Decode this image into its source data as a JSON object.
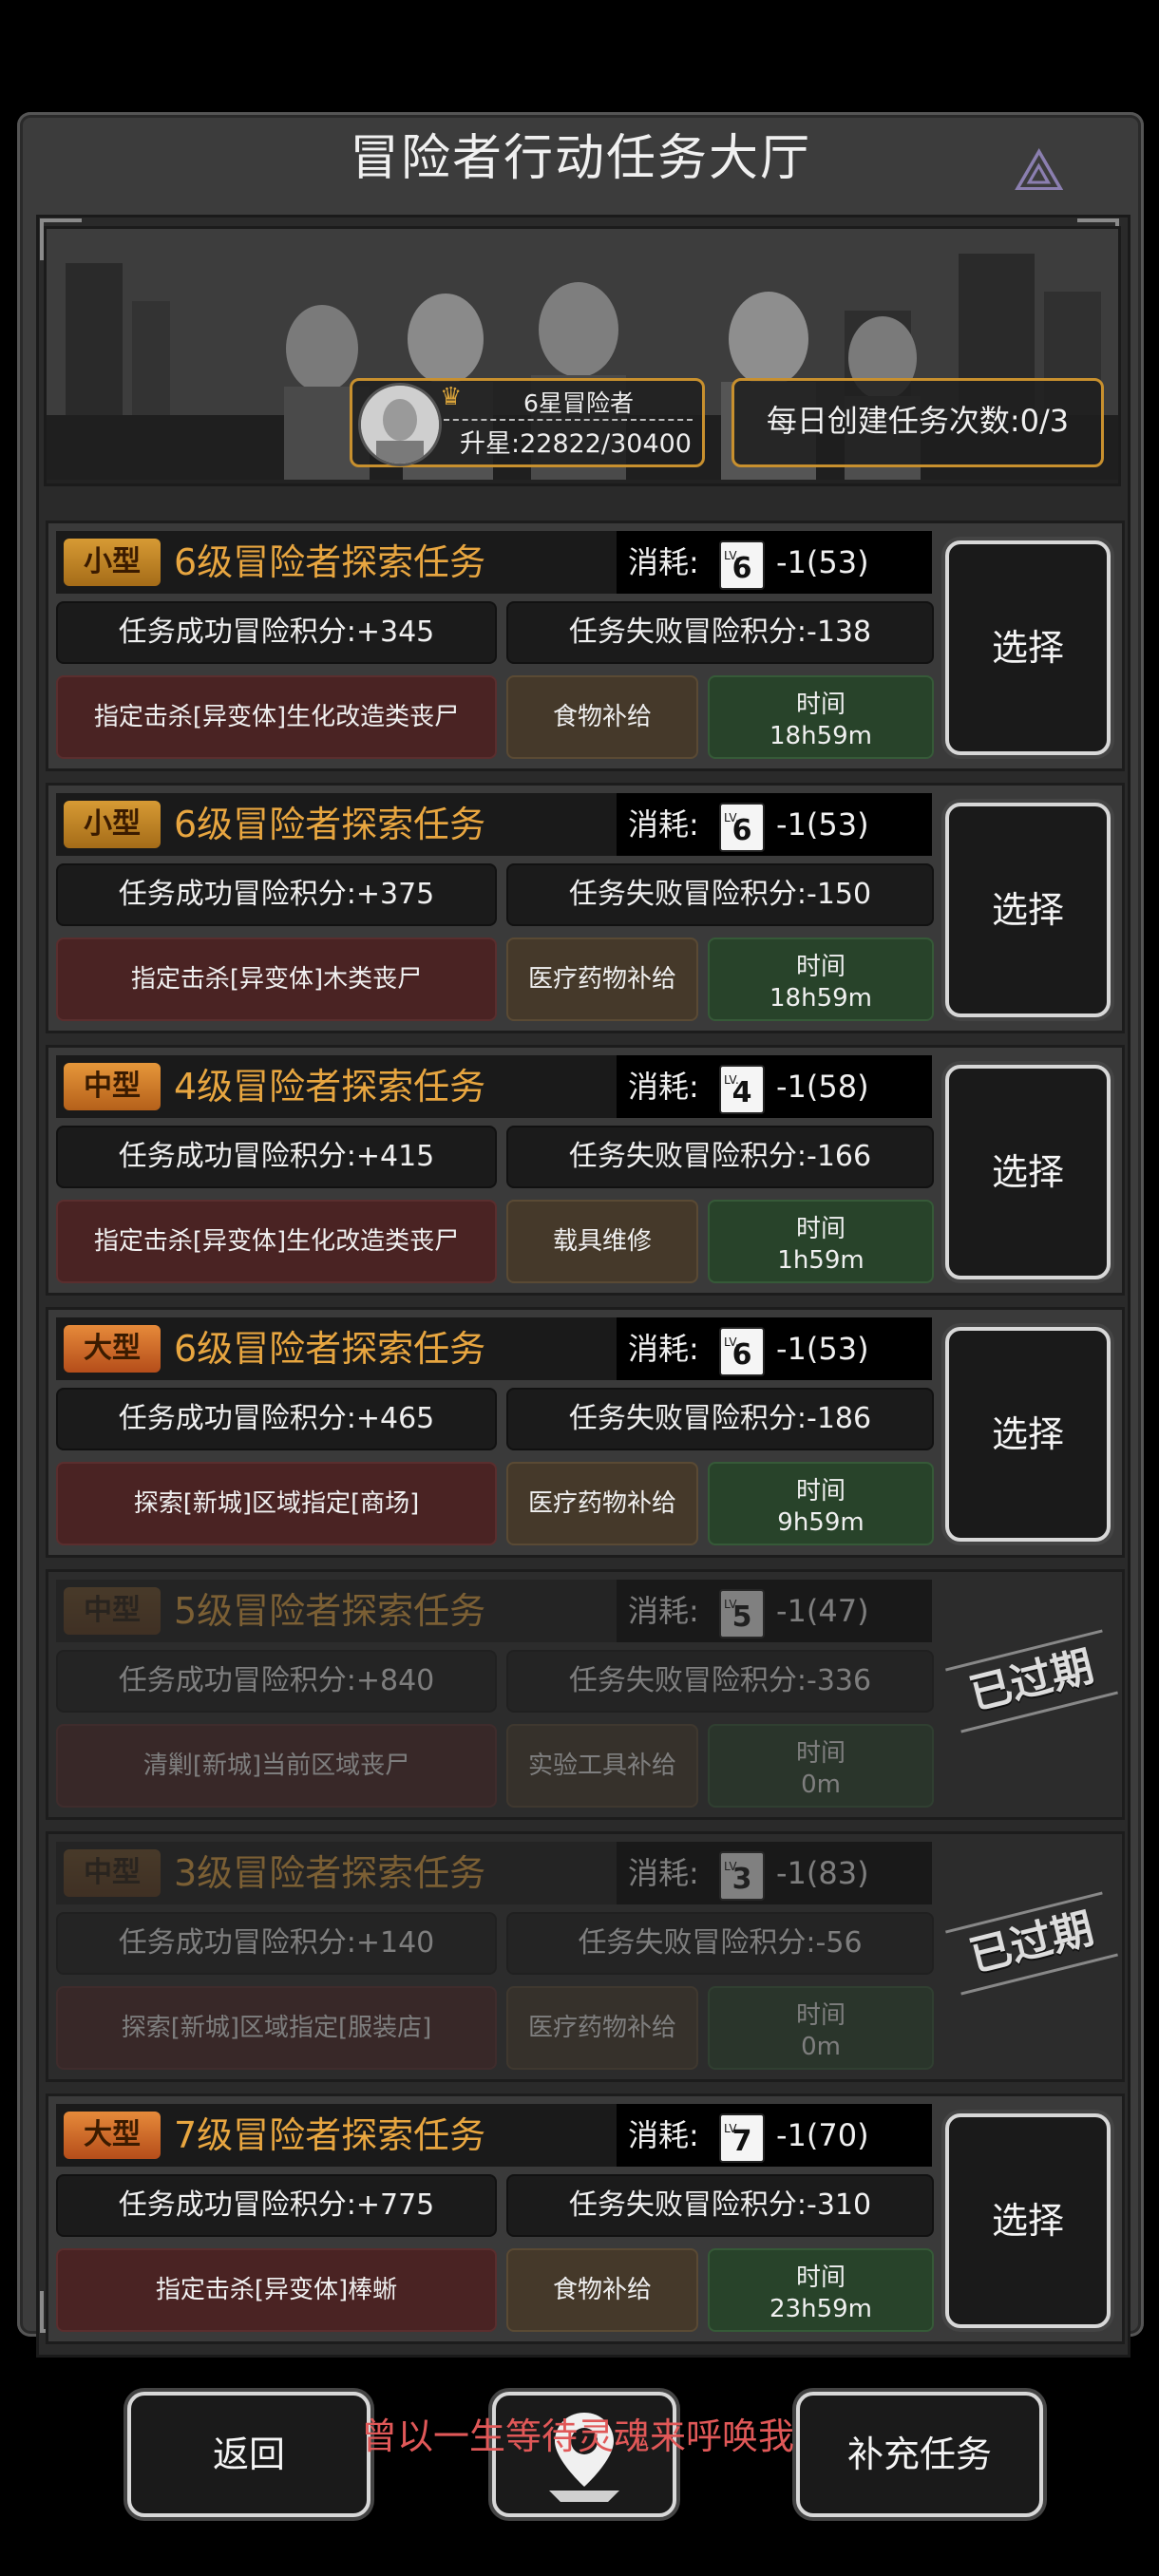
{
  "header": {
    "title": "冒险者行动任务大厅"
  },
  "banner": {
    "rank_name": "6星冒险者",
    "rank_progress": "升星:22822/30400",
    "daily_create": "每日创建任务次数:0/3"
  },
  "tasks": [
    {
      "size": "小型",
      "title": "6级冒险者探索任务",
      "cost_label": "消耗:",
      "lv_card": "6",
      "cost": "-1(53)",
      "success": "任务成功冒险积分:+345",
      "fail": "任务失败冒险积分:-138",
      "target": "指定击杀[异变体]生化改造类丧尸",
      "reward": "食物补给",
      "time_label": "时间",
      "time": "18h59m",
      "action": "选择"
    },
    {
      "size": "小型",
      "title": "6级冒险者探索任务",
      "cost_label": "消耗:",
      "lv_card": "6",
      "cost": "-1(53)",
      "success": "任务成功冒险积分:+375",
      "fail": "任务失败冒险积分:-150",
      "target": "指定击杀[异变体]木类丧尸",
      "reward": "医疗药物补给",
      "time_label": "时间",
      "time": "18h59m",
      "action": "选择"
    },
    {
      "size": "中型",
      "title": "4级冒险者探索任务",
      "cost_label": "消耗:",
      "lv_card": "4",
      "cost": "-1(58)",
      "success": "任务成功冒险积分:+415",
      "fail": "任务失败冒险积分:-166",
      "target": "指定击杀[异变体]生化改造类丧尸",
      "reward": "载具维修",
      "time_label": "时间",
      "time": "1h59m",
      "action": "选择"
    },
    {
      "size": "大型",
      "title": "6级冒险者探索任务",
      "cost_label": "消耗:",
      "lv_card": "6",
      "cost": "-1(53)",
      "success": "任务成功冒险积分:+465",
      "fail": "任务失败冒险积分:-186",
      "target": "探索[新城]区域指定[商场]",
      "reward": "医疗药物补给",
      "time_label": "时间",
      "time": "9h59m",
      "action": "选择"
    },
    {
      "size": "中型",
      "title": "5级冒险者探索任务",
      "cost_label": "消耗:",
      "lv_card": "5",
      "cost": "-1(47)",
      "success": "任务成功冒险积分:+840",
      "fail": "任务失败冒险积分:-336",
      "target": "清剿[新城]当前区域丧尸",
      "reward": "实验工具补给",
      "time_label": "时间",
      "time": "0m",
      "expired": "已过期"
    },
    {
      "size": "中型",
      "title": "3级冒险者探索任务",
      "cost_label": "消耗:",
      "lv_card": "3",
      "cost": "-1(83)",
      "success": "任务成功冒险积分:+140",
      "fail": "任务失败冒险积分:-56",
      "target": "探索[新城]区域指定[服装店]",
      "reward": "医疗药物补给",
      "time_label": "时间",
      "time": "0m",
      "expired": "已过期"
    },
    {
      "size": "大型",
      "title": "7级冒险者探索任务",
      "cost_label": "消耗:",
      "lv_card": "7",
      "cost": "-1(70)",
      "success": "任务成功冒险积分:+775",
      "fail": "任务失败冒险积分:-310",
      "target": "指定击杀[异变体]棒蜥",
      "reward": "食物补给",
      "time_label": "时间",
      "time": "23h59m",
      "action": "选择"
    }
  ],
  "footer": {
    "back": "返回",
    "supply": "补充任务",
    "overlay_text": "曾以一生等待灵魂来呼唤我"
  }
}
